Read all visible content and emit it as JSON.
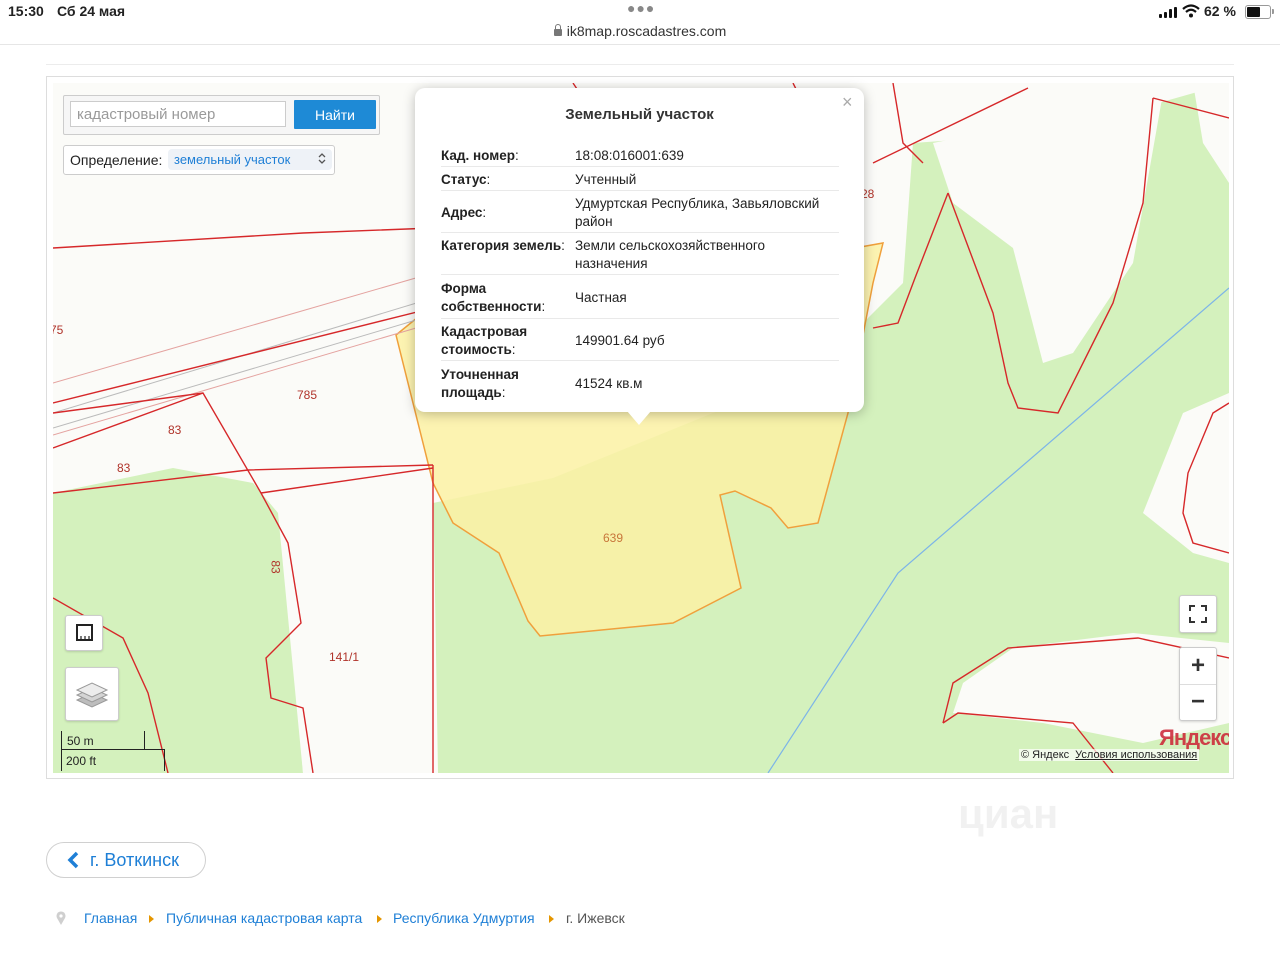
{
  "status_bar": {
    "time": "15:30",
    "date": "Сб 24 мая",
    "url": "ik8map.roscadastres.com",
    "battery_percent": "62 %",
    "battery_level": 0.62
  },
  "search": {
    "placeholder": "кадастровый номер",
    "button_label": "Найти"
  },
  "definition": {
    "label": "Определение:",
    "selected": "земельный участок"
  },
  "map": {
    "parcel_labels": [
      {
        "id": "p785",
        "text": "785"
      },
      {
        "id": "p83a",
        "text": "83"
      },
      {
        "id": "p83b",
        "text": "83"
      },
      {
        "id": "p83c",
        "text": "83"
      },
      {
        "id": "p141",
        "text": "141/1"
      },
      {
        "id": "p75",
        "text": "75"
      },
      {
        "id": "p28",
        "text": "28"
      },
      {
        "id": "p639",
        "text": "639"
      }
    ],
    "scale_metric": "50 m",
    "scale_imperial": "200 ft",
    "provider_logo": "Яндекс",
    "copyright": "© Яндекс",
    "terms_link": "Условия использования",
    "zoom_in_label": "+",
    "zoom_out_label": "−",
    "colors": {
      "parcel_border": "#d6282a",
      "selected_fill": "#fbf1a4",
      "selected_border": "#f0a03c",
      "green_area": "#d4f1bd",
      "water_line": "#7cb4e8"
    }
  },
  "popup": {
    "title": "Земельный участок",
    "close_label": "×",
    "rows": [
      {
        "key": "Кад. номер",
        "value": "18:08:016001:639"
      },
      {
        "key": "Статус",
        "value": "Учтенный"
      },
      {
        "key": "Адрес",
        "value": "Удмуртская Республика, Завьяловский район"
      },
      {
        "key": "Категория земель",
        "value": "Земли сельскохозяйственного назначения"
      },
      {
        "key": "Форма собственности",
        "value": "Частная"
      },
      {
        "key": "Кадастровая стоимость",
        "value": "149901.64 руб"
      },
      {
        "key": "Уточненная площадь",
        "value": "41524 кв.м"
      }
    ]
  },
  "footer": {
    "back_label": "г. Воткинск",
    "breadcrumbs": [
      {
        "label": "Главная",
        "link": true
      },
      {
        "label": "Публичная кадастровая карта",
        "link": true
      },
      {
        "label": "Республика Удмуртия",
        "link": true
      },
      {
        "label": "г. Ижевск",
        "link": false
      }
    ],
    "watermark": "циан"
  }
}
